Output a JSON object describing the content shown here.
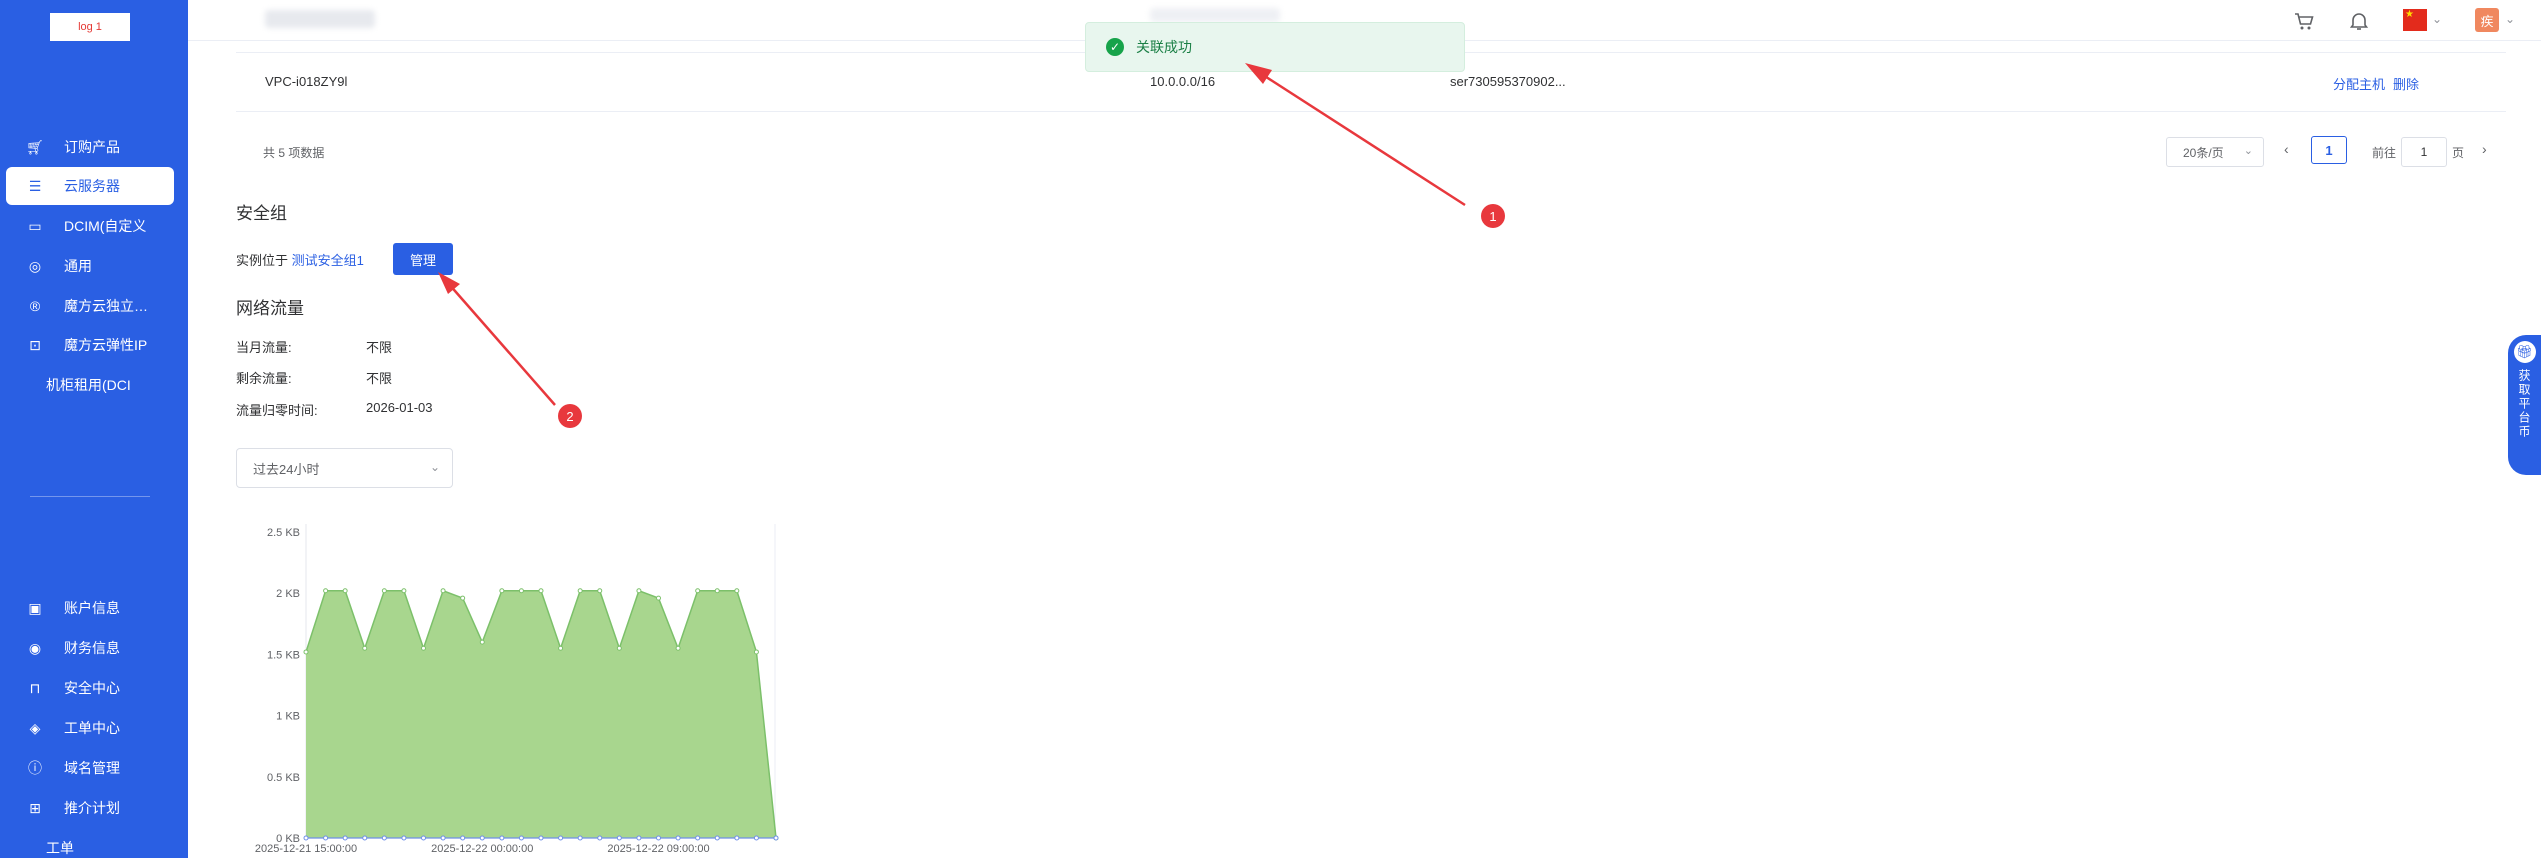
{
  "app": {
    "logo_text": "log 1"
  },
  "sidebar": {
    "items": [
      {
        "label": "订购产品",
        "icon": "cart-icon",
        "glyph": "🛒︎",
        "active": false
      },
      {
        "label": "云服务器",
        "icon": "server-icon",
        "glyph": "☰",
        "active": true
      },
      {
        "label": "DCIM(自定义",
        "icon": "save-icon",
        "glyph": "▭",
        "active": false
      },
      {
        "label": "通用",
        "icon": "global-icon",
        "glyph": "◎",
        "active": false
      },
      {
        "label": "魔方云独立…",
        "icon": "cloud-icon",
        "glyph": "®",
        "active": false
      },
      {
        "label": "魔方云弹性IP",
        "icon": "ip-icon",
        "glyph": "⊡",
        "active": false
      },
      {
        "label": "机柜租用(DCI",
        "icon": "",
        "glyph": "",
        "active": false
      }
    ],
    "bottom_items": [
      {
        "label": "账户信息",
        "icon": "account-icon",
        "glyph": "▣"
      },
      {
        "label": "财务信息",
        "icon": "finance-icon",
        "glyph": "◉"
      },
      {
        "label": "安全中心",
        "icon": "lock-icon",
        "glyph": "⊓"
      },
      {
        "label": "工单中心",
        "icon": "ticket-icon",
        "glyph": "◈"
      },
      {
        "label": "域名管理",
        "icon": "domain-icon",
        "glyph": "ⓘ"
      },
      {
        "label": "推介计划",
        "icon": "grid-icon",
        "glyph": "⊞"
      },
      {
        "label": "工单",
        "icon": "",
        "glyph": ""
      }
    ]
  },
  "header": {
    "cart_icon": "cart-icon",
    "bell_icon": "bell-icon",
    "language_flag": "china-flag-icon",
    "avatar_text": "疾"
  },
  "table": {
    "row": {
      "name": "VPC-i018ZY9l",
      "cidr": "10.0.0.0/16",
      "server": "ser730595370902...",
      "action_assign": "分配主机",
      "action_delete": "删除"
    }
  },
  "pagination": {
    "total_text": "共 5 项数据",
    "page_size": "20条/页",
    "current_page": "1",
    "goto_label": "前往",
    "goto_value": "1",
    "page_suffix": "页"
  },
  "security_group": {
    "title": "安全组",
    "prefix": "实例位于",
    "group_link": "测试安全组1",
    "manage_button": "管理"
  },
  "traffic": {
    "title": "网络流量",
    "rows": [
      {
        "label": "当月流量:",
        "value": "不限"
      },
      {
        "label": "剩余流量:",
        "value": "不限"
      },
      {
        "label": "流量归零时间:",
        "value": "2026-01-03"
      }
    ],
    "range_select": "过去24小时"
  },
  "toast": {
    "message": "关联成功",
    "color": "#17a34a"
  },
  "float_tab": {
    "text": "获取平台币"
  },
  "annotations": [
    {
      "number": "1"
    },
    {
      "number": "2"
    }
  ],
  "colors": {
    "brand": "#2a5fe3",
    "area_fill": "#a8d68e",
    "area_line": "#7cc06a",
    "marker": "#e8383d"
  },
  "chart_data": {
    "type": "area",
    "title": "",
    "xlabel": "",
    "ylabel": "",
    "y_ticks": [
      "0 KB",
      "0.5 KB",
      "1 KB",
      "1.5 KB",
      "2 KB",
      "2.5 KB"
    ],
    "x_ticks": [
      "2025-12-21 15:00:00",
      "2025-12-22 00:00:00",
      "2025-12-22 09:00:00"
    ],
    "ylim": [
      0,
      2.5
    ],
    "y_unit": "KB",
    "grid": false,
    "series": [
      {
        "values": [
          1.52,
          2.02,
          2.02,
          1.55,
          2.02,
          2.02,
          1.55,
          2.02,
          1.96,
          1.6,
          2.02,
          2.02,
          2.02,
          1.55,
          2.02,
          2.02,
          1.55,
          2.02,
          1.96,
          1.55,
          2.02,
          2.02,
          2.02,
          1.52,
          0
        ]
      },
      {
        "values": [
          0,
          0,
          0,
          0,
          0,
          0,
          0,
          0,
          0,
          0,
          0,
          0,
          0,
          0,
          0,
          0,
          0,
          0,
          0,
          0,
          0,
          0,
          0,
          0,
          0
        ]
      }
    ]
  }
}
